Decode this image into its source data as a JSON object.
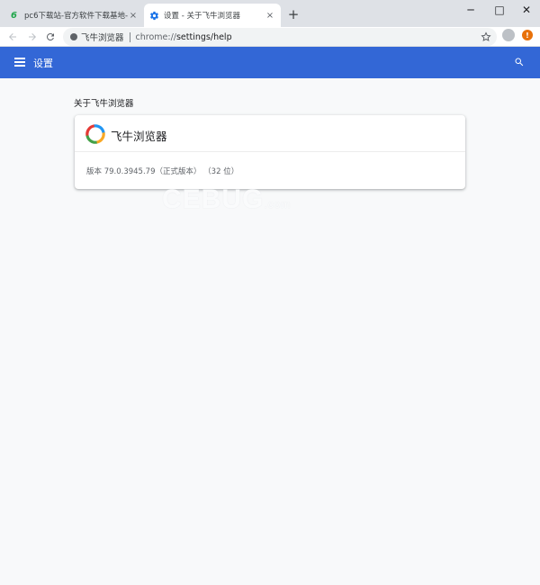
{
  "tabs": [
    {
      "title": "pc6下载站-官方软件下载基地-全",
      "favicon": "pc6-icon",
      "close": "×"
    },
    {
      "title": "设置 - 关于飞牛浏览器",
      "favicon": "settings-gear-icon",
      "close": "×"
    }
  ],
  "new_tab": "+",
  "window_controls": {
    "minimize": "─",
    "maximize": "□",
    "close": "✕"
  },
  "omnibox": {
    "site_name": "飞牛浏览器",
    "url_scheme": "chrome://",
    "url_rest": "settings/help"
  },
  "update_badge": "!",
  "header": {
    "title": "设置"
  },
  "section_title": "关于飞牛浏览器",
  "product": {
    "name": "飞牛浏览器",
    "version": "版本 79.0.3945.79（正式版本）  （32 位）"
  },
  "watermark": {
    "main": "CEBUG",
    "suffix": ".com"
  },
  "colors": {
    "header": "#3367d6",
    "tabstrip": "#dee1e6",
    "content_bg": "#f8f9fa",
    "badge": "#e8710a"
  }
}
